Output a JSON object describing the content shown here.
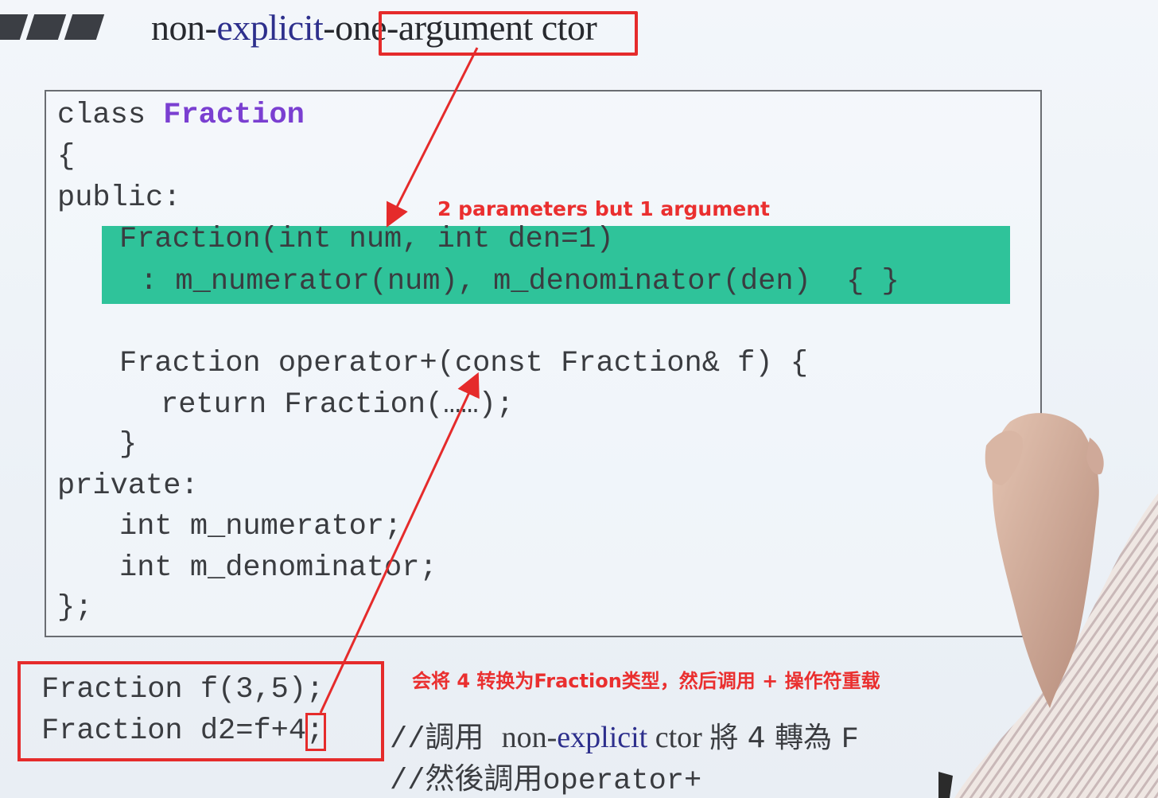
{
  "slide": {
    "title": {
      "part1": "non-",
      "part2": "explicit",
      "part3": "-",
      "part4": "one-argument",
      "part5": " ctor"
    },
    "code_lines": [
      {
        "text": "class ",
        "keyword": "Fraction"
      },
      {
        "text": "{"
      },
      {
        "text": "public:"
      },
      {
        "text": "Fraction(int num, int den=1)"
      },
      {
        "text": ": m_numerator(num), m_denominator(den)  { }"
      },
      {
        "text": "Fraction operator+(const Fraction& f) {"
      },
      {
        "text": "return Fraction(……);"
      },
      {
        "text": "}"
      },
      {
        "text": "private:"
      },
      {
        "text": "int m_numerator;"
      },
      {
        "text": "int m_denominator;"
      },
      {
        "text": "};"
      }
    ],
    "usage_lines": [
      {
        "text": "Fraction f(3,5);"
      },
      {
        "text": "Fraction d2=f+4;"
      }
    ],
    "comment1": {
      "prefix": "//調用 ",
      "word1": "non-",
      "word2": "explicit",
      "word3": " ctor ",
      "cjk": "將 4 轉為 ",
      "tail": "F"
    },
    "comment2": {
      "prefix": "//然後調用",
      "code": "operator+"
    }
  },
  "annotations": {
    "note_top": "2 parameters but 1 argument",
    "note_bottom": "会将 4 转换为Fraction类型，然后调用 + 操作符重载"
  },
  "colors": {
    "annotation_red": "#e52b2b",
    "highlight_green": "#2fc39a",
    "keyword_purple": "#7a3fd1",
    "title_blue": "#2d2f8c"
  }
}
